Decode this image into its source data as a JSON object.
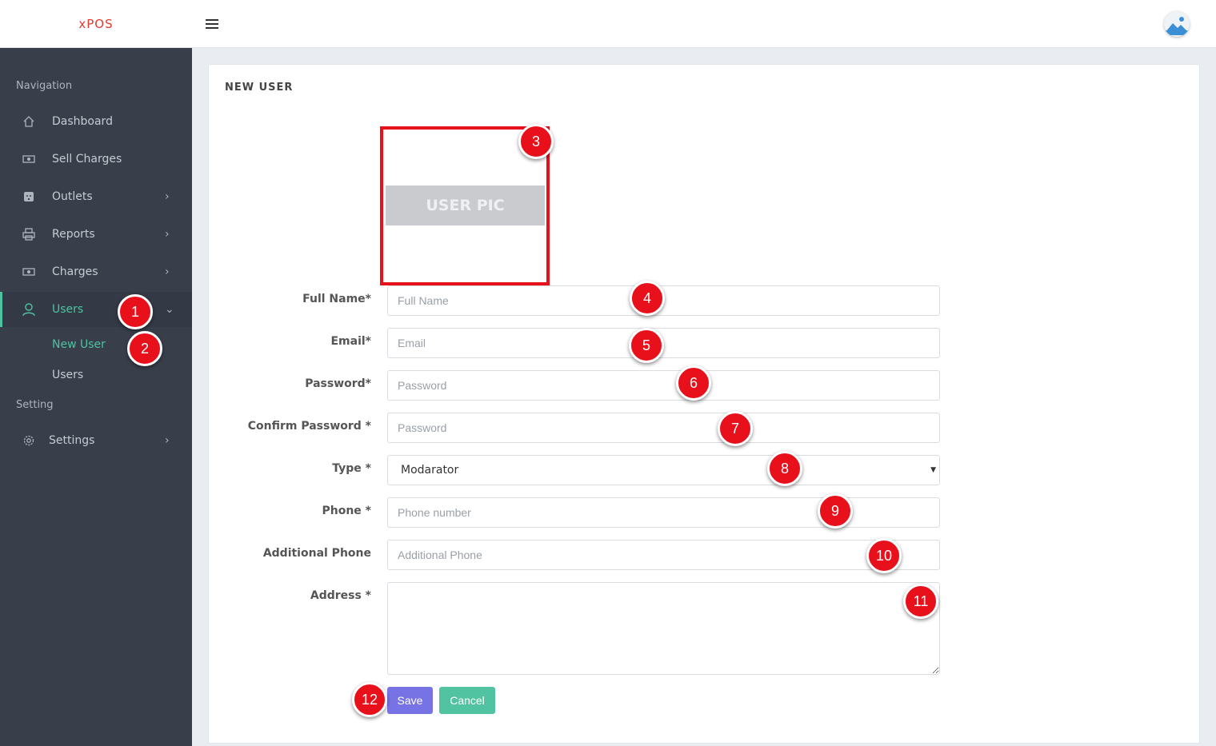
{
  "app": {
    "logo": "xPOS"
  },
  "header": {
    "menu_icon": "hamburger-icon",
    "avatar_icon": "image-icon"
  },
  "sidebar": {
    "navigation_header": "Navigation",
    "setting_header": "Setting",
    "items": [
      {
        "label": "Dashboard",
        "icon": "home-icon"
      },
      {
        "label": "Sell Charges",
        "icon": "money-icon"
      },
      {
        "label": "Outlets",
        "icon": "outlet-icon"
      },
      {
        "label": "Reports",
        "icon": "printer-icon"
      },
      {
        "label": "Charges",
        "icon": "money-icon"
      },
      {
        "label": "Users",
        "icon": "user-icon"
      },
      {
        "label": "Settings",
        "icon": "gear-icon"
      }
    ],
    "users_submenu": [
      "New User",
      "Users"
    ]
  },
  "form": {
    "title": "NEW USER",
    "user_pic": "USER PIC",
    "full_name": {
      "label": "Full Name*",
      "placeholder": "Full Name",
      "value": ""
    },
    "email": {
      "label": "Email*",
      "placeholder": "Email",
      "value": ""
    },
    "password": {
      "label": "Password*",
      "placeholder": "Password",
      "value": ""
    },
    "confirm_password": {
      "label": "Confirm Password *",
      "placeholder": "Password",
      "value": ""
    },
    "type": {
      "label": "Type *",
      "selected": "Modarator"
    },
    "phone": {
      "label": "Phone *",
      "placeholder": "Phone number",
      "value": ""
    },
    "additional_phone": {
      "label": "Additional Phone",
      "placeholder": "Additional Phone",
      "value": ""
    },
    "address": {
      "label": "Address *",
      "value": ""
    },
    "save_label": "Save",
    "cancel_label": "Cancel"
  },
  "annotations": [
    "1",
    "2",
    "3",
    "4",
    "5",
    "6",
    "7",
    "8",
    "9",
    "10",
    "11",
    "12"
  ],
  "colors": {
    "accent": "#4fc2a0",
    "sidebar": "#383f4b",
    "save": "#7873e4",
    "cancel": "#52c3a1",
    "badge": "#e8101b",
    "logo": "#e23b2e"
  }
}
